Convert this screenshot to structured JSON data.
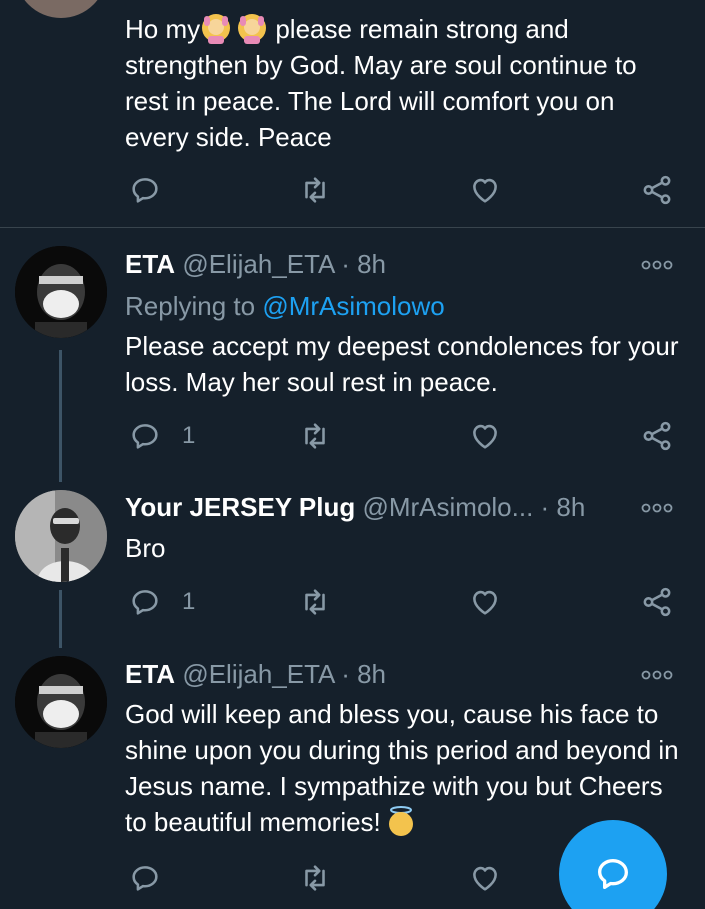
{
  "tweets": [
    {
      "body_prefix": "Ho my",
      "body_suffix": " please remain strong and strengthen by God. May are soul continue to rest in peace. The Lord will comfort you on every side. Peace",
      "emoji": [
        "person-gesturing-ok-emoji",
        "person-gesturing-ok-emoji"
      ],
      "reply_count": ""
    },
    {
      "name": "ETA",
      "handle": "@Elijah_ETA",
      "sep": " · ",
      "time": "8h",
      "replying_label": "Replying to ",
      "replying_handle": "@MrAsimolowo",
      "body": "Please accept my deepest condolences for your loss. May her soul rest in peace.",
      "reply_count": "1"
    },
    {
      "name": "Your JERSEY Plug",
      "handle": "@MrAsimolo...",
      "sep": " · ",
      "time": "8h",
      "body": "Bro",
      "reply_count": "1"
    },
    {
      "name": "ETA",
      "handle": "@Elijah_ETA",
      "sep": " · ",
      "time": "8h",
      "body": "God will keep and bless you, cause his face to shine upon you during this period and beyond in Jesus name. I sympathize with you but Cheers to beautiful memories!",
      "trailing_emoji": "smiling-face-with-halo-emoji",
      "reply_count": ""
    }
  ],
  "fab": {
    "icon": "compose-reply-icon"
  },
  "colors": {
    "background": "#15202b",
    "text_primary": "#ffffff",
    "text_secondary": "#8899a6",
    "link": "#1da1f2",
    "divider": "#38444d",
    "fab": "#1da1f2"
  }
}
